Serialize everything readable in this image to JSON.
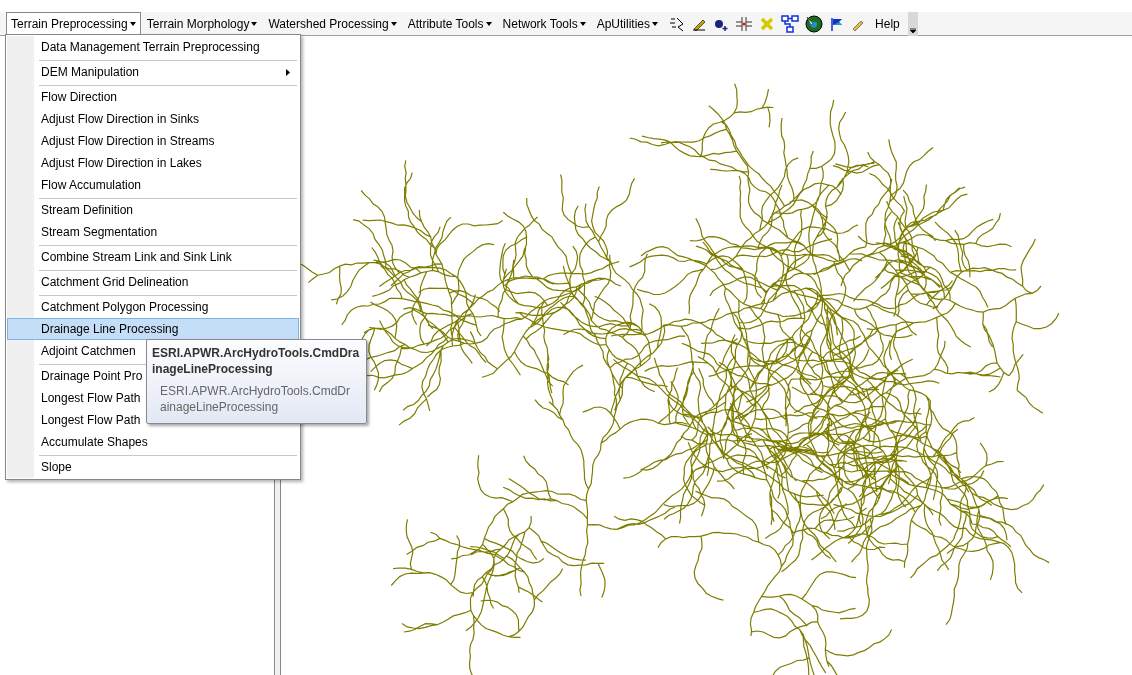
{
  "menus": [
    {
      "label": "Terrain Preprocessing",
      "dropdown": true,
      "selected": true
    },
    {
      "label": "Terrain Morphology",
      "dropdown": true,
      "selected": false
    },
    {
      "label": "Watershed Processing",
      "dropdown": true,
      "selected": false
    },
    {
      "label": "Attribute Tools",
      "dropdown": true,
      "selected": false
    },
    {
      "label": "Network Tools",
      "dropdown": true,
      "selected": false
    },
    {
      "label": "ApUtilities",
      "dropdown": true,
      "selected": false
    }
  ],
  "help_menu": {
    "label": "Help"
  },
  "dropdown_items": [
    {
      "label": "Data Management Terrain Preprocessing",
      "submenu": false,
      "separator_before": false,
      "selected": false
    },
    {
      "label": "DEM Manipulation",
      "submenu": true,
      "separator_before": true,
      "selected": false
    },
    {
      "label": "Flow Direction",
      "submenu": false,
      "separator_before": true,
      "selected": false
    },
    {
      "label": "Adjust Flow Direction in Sinks",
      "submenu": false,
      "separator_before": false,
      "selected": false
    },
    {
      "label": "Adjust Flow Direction in Streams",
      "submenu": false,
      "separator_before": false,
      "selected": false
    },
    {
      "label": "Adjust Flow Direction in Lakes",
      "submenu": false,
      "separator_before": false,
      "selected": false
    },
    {
      "label": "Flow Accumulation",
      "submenu": false,
      "separator_before": false,
      "selected": false
    },
    {
      "label": "Stream Definition",
      "submenu": false,
      "separator_before": true,
      "selected": false
    },
    {
      "label": "Stream Segmentation",
      "submenu": false,
      "separator_before": false,
      "selected": false
    },
    {
      "label": "Combine Stream Link and Sink Link",
      "submenu": false,
      "separator_before": true,
      "selected": false
    },
    {
      "label": "Catchment Grid Delineation",
      "submenu": false,
      "separator_before": true,
      "selected": false
    },
    {
      "label": "Catchment Polygon Processing",
      "submenu": false,
      "separator_before": true,
      "selected": false
    },
    {
      "label": "Drainage Line Processing",
      "submenu": false,
      "separator_before": false,
      "selected": true
    },
    {
      "label": "Adjoint Catchmen",
      "separator_before": false,
      "selected": false
    },
    {
      "label": "Drainage Point Pro",
      "separator_before": true,
      "selected": false
    },
    {
      "label": "Longest Flow Path",
      "separator_before": false,
      "selected": false
    },
    {
      "label": "Longest Flow Path",
      "separator_before": false,
      "selected": false
    },
    {
      "label": "Accumulate Shapes",
      "submenu": false,
      "separator_before": false,
      "selected": false
    },
    {
      "label": "Slope",
      "submenu": false,
      "separator_before": true,
      "selected": false
    }
  ],
  "tooltip": {
    "title": "ESRI.APWR.ArcHydroTools.CmdDrainageLineProcessing",
    "description": "ESRI.APWR.ArcHydroTools.CmdDrainageLineProcessing"
  }
}
